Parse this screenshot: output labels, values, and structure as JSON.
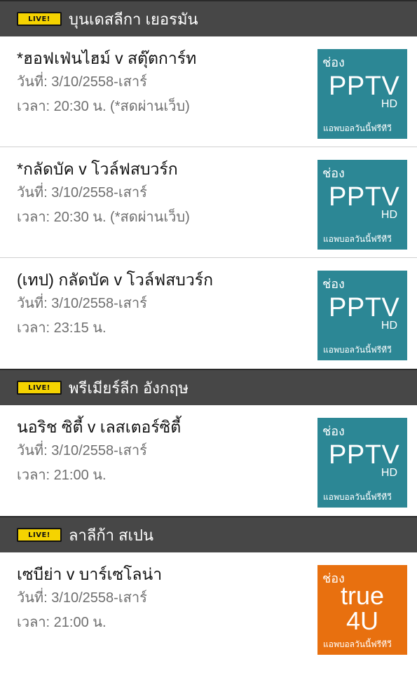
{
  "live_badge_label": "LIVE!",
  "leagues": [
    {
      "title": "บุนเดสลีกา เยอรมัน",
      "matches": [
        {
          "title": "*ฮอฟเฟ่นไฮม์ v สตุ๊ตการ์ท",
          "date": "วันที่: 3/10/2558-เสาร์",
          "time": "เวลา: 20:30 น. (*สดผ่านเว็บ)",
          "channel": {
            "prefix": "ช่อง",
            "name": "PPTV",
            "sub": "HD",
            "tagline": "แอพบอลวันนี้ฟรีทีวี",
            "color": "#2c8795"
          }
        },
        {
          "title": "*กลัดบัค v โวล์ฟสบวร์ก",
          "date": "วันที่: 3/10/2558-เสาร์",
          "time": "เวลา: 20:30 น. (*สดผ่านเว็บ)",
          "channel": {
            "prefix": "ช่อง",
            "name": "PPTV",
            "sub": "HD",
            "tagline": "แอพบอลวันนี้ฟรีทีวี",
            "color": "#2c8795"
          }
        },
        {
          "title": "(เทป) กลัดบัค v โวล์ฟสบวร์ก",
          "date": "วันที่: 3/10/2558-เสาร์",
          "time": "เวลา: 23:15 น.",
          "channel": {
            "prefix": "ช่อง",
            "name": "PPTV",
            "sub": "HD",
            "tagline": "แอพบอลวันนี้ฟรีทีวี",
            "color": "#2c8795"
          }
        }
      ]
    },
    {
      "title": "พรีเมียร์ลีก อังกฤษ",
      "matches": [
        {
          "title": "นอริช ซิตี้ v เลสเตอร์ซิตี้",
          "date": "วันที่: 3/10/2558-เสาร์",
          "time": "เวลา: 21:00 น.",
          "channel": {
            "prefix": "ช่อง",
            "name": "PPTV",
            "sub": "HD",
            "tagline": "แอพบอลวันนี้ฟรีทีวี",
            "color": "#2c8795"
          }
        }
      ]
    },
    {
      "title": "ลาลีก้า สเปน",
      "matches": [
        {
          "title": "เซบีย่า v บาร์เซโลน่า",
          "date": "วันที่: 3/10/2558-เสาร์",
          "time": "เวลา: 21:00 น.",
          "channel": {
            "prefix": "ช่อง",
            "name": "true",
            "sub": "4U",
            "tagline": "แอพบอลวันนี้ฟรีทีวี",
            "color": "#e8700f"
          }
        }
      ]
    }
  ],
  "colors": {
    "header_bg": "#474747",
    "badge": "#f5d300",
    "meta_text": "#6f6f6f"
  }
}
